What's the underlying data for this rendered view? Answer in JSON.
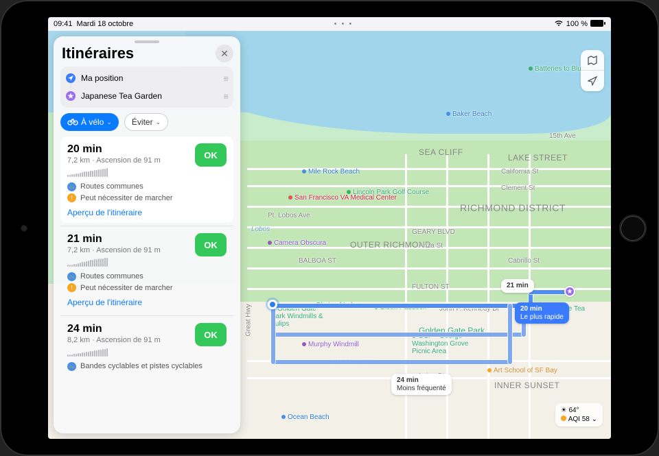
{
  "status": {
    "time": "09:41",
    "date": "Mardi 18 octobre",
    "battery": "100 %"
  },
  "panel": {
    "title": "Itinéraires",
    "waypoints": {
      "from": "Ma position",
      "to": "Japanese Tea Garden"
    },
    "mode_label": "À vélo",
    "avoid_label": "Éviter"
  },
  "routes": [
    {
      "time": "20 min",
      "distance": "7,2 km",
      "ascent": "Ascension de 91 m",
      "tag1": "Routes communes",
      "tag2": "Peut nécessiter de marcher",
      "ok": "OK",
      "preview": "Aperçu de l'itinéraire"
    },
    {
      "time": "21 min",
      "distance": "7,2 km",
      "ascent": "Ascension de 91 m",
      "tag1": "Routes communes",
      "tag2": "Peut nécessiter de marcher",
      "ok": "OK",
      "preview": "Aperçu de l'itinéraire"
    },
    {
      "time": "24 min",
      "distance": "8,2 km",
      "ascent": "Ascension de 91 m",
      "tag1": "Bandes cyclables et pistes cyclables",
      "tag2": "",
      "ok": "OK",
      "preview": ""
    }
  ],
  "map": {
    "pois": {
      "bluffs": "Batteries to Bluffs Trail",
      "baker": "Baker Beach",
      "milerock": "Mile Rock Beach",
      "lincoln": "Lincoln Park Golf Course",
      "vamc": "San Francisco VA Medical Center",
      "camera": "Camera Obscura",
      "lobos": "Lobos",
      "ggpw": "Golden Gate Park Windmills & Tulips",
      "chain": "Chain of Lakes",
      "bison": "Bison Paddock",
      "murphy": "Murphy Windmill",
      "ggp": "Golden Gate Park",
      "ggpicnic": "GGP - George Washington Grove Picnic Area",
      "artschool": "Art School of SF Bay",
      "ocean": "Ocean Beach",
      "tea": "Japanese Tea Garden"
    },
    "districts": {
      "seacliff": "SEA CLIFF",
      "lake": "LAKE STREET",
      "richmond": "RICHMOND DISTRICT",
      "outer": "OUTER RICHMOND",
      "innersunset": "INNER SUNSET"
    },
    "streets": {
      "s15": "15th Ave",
      "cal": "California St",
      "clement": "Clement St",
      "geary": "GEARY BLVD",
      "anza": "Anza St",
      "balboa": "BALBOA ST",
      "cabrillo": "Cabrillo St",
      "fulton": "FULTON ST",
      "jfk": "John F. Kennedy Dr",
      "lincolnw": "LINCOLN WAY",
      "irving": "Irving St",
      "lobosave": "Pt. Lobos Ave",
      "greathwy": "Great Hwy"
    },
    "callouts": {
      "c21": "21 min",
      "c20a": "20 min",
      "c20b": "Le plus rapide",
      "c24a": "24 min",
      "c24b": "Moins fréquenté"
    },
    "weather": {
      "temp": "64°",
      "aqi_label": "AQI",
      "aqi_val": "58"
    }
  }
}
